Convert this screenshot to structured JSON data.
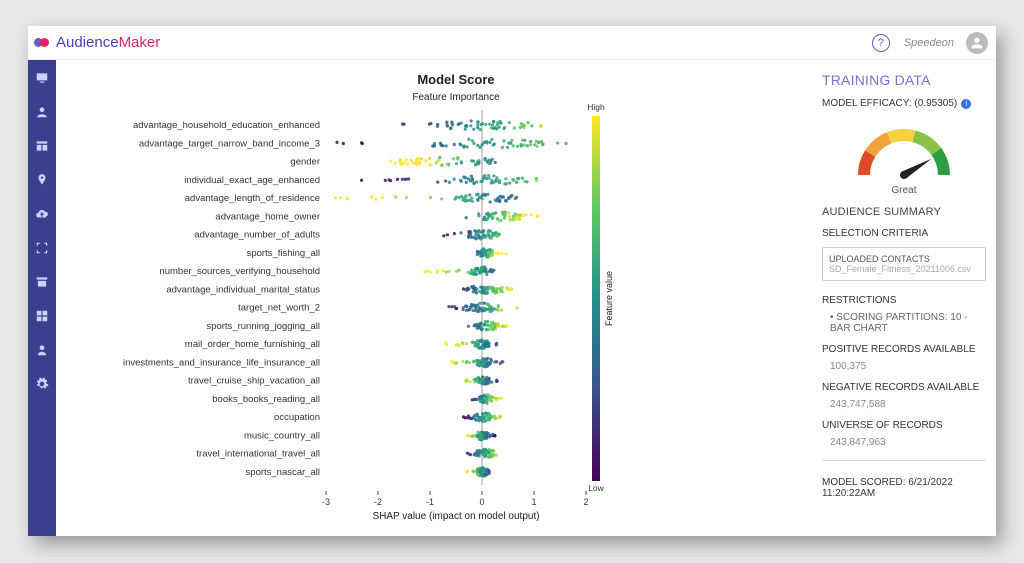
{
  "header": {
    "brand_a": "Audience",
    "brand_b": "Maker",
    "tenant": "Speedeon",
    "help_glyph": "?"
  },
  "nav_icons": [
    "monitor-icon",
    "users-icon",
    "table-icon",
    "pin-icon",
    "cloud-upload-icon",
    "scan-icon",
    "archive-icon",
    "app-grid-icon",
    "user-icon",
    "gear-icon"
  ],
  "panel": {
    "title": "TRAINING DATA",
    "efficacy_label": "MODEL EFFICACY: (0.95305)",
    "gauge_value": 0.83,
    "gauge_label": "Great",
    "summary_title": "AUDIENCE SUMMARY",
    "criteria_title": "SELECTION CRITERIA",
    "criteria_box_title": "UPLOADED CONTACTS",
    "criteria_box_value": "SD_Female_Fitness_20211006.csv",
    "restrictions_title": "RESTRICTIONS",
    "restrictions_item": "SCORING PARTITIONS: 10 - BAR CHART",
    "positive_label": "POSITIVE RECORDS AVAILABLE",
    "positive_value": "100,375",
    "negative_label": "NEGATIVE RECORDS AVAILABLE",
    "negative_value": "243,747,588",
    "universe_label": "UNIVERSE OF RECORDS",
    "universe_value": "243,847,963",
    "scored_label": "MODEL SCORED: 6/21/2022 11:20:22AM"
  },
  "chart_data": {
    "type": "beeswarm",
    "title": "Model Score",
    "subtitle": "Feature Importance",
    "xlabel": "SHAP value (impact on model output)",
    "colorbar_label": "Feature value",
    "colorbar_high": "High",
    "colorbar_low": "Low",
    "xlim": [
      -3,
      2
    ],
    "xticks": [
      -3,
      -2,
      -1,
      0,
      1,
      2
    ],
    "features": [
      {
        "name": "advantage_household_education_enhanced",
        "spread": [
          -1.8,
          1.3
        ],
        "bulk": [
          -0.9,
          0.9
        ],
        "tilt": 0.5
      },
      {
        "name": "advantage_target_narrow_band_income_3",
        "spread": [
          -3.0,
          2.0
        ],
        "bulk": [
          -1.0,
          1.2
        ],
        "tilt": 0.6
      },
      {
        "name": "gender",
        "spread": [
          -1.8,
          0.3
        ],
        "bulk": [
          -1.6,
          0.2
        ],
        "tilt": -0.7
      },
      {
        "name": "individual_exact_age_enhanced",
        "spread": [
          -2.6,
          1.2
        ],
        "bulk": [
          -0.7,
          0.9
        ],
        "tilt": 0.3
      },
      {
        "name": "advantage_length_of_residence",
        "spread": [
          -2.9,
          0.8
        ],
        "bulk": [
          -0.5,
          0.6
        ],
        "tilt": -0.2
      },
      {
        "name": "advantage_home_owner",
        "spread": [
          -0.4,
          1.1
        ],
        "bulk": [
          -0.1,
          0.8
        ],
        "tilt": 0.4
      },
      {
        "name": "advantage_number_of_adults",
        "spread": [
          -0.8,
          0.5
        ],
        "bulk": [
          -0.3,
          0.3
        ],
        "tilt": 0.0
      },
      {
        "name": "sports_fishing_all",
        "spread": [
          -0.1,
          0.5
        ],
        "bulk": [
          -0.05,
          0.2
        ],
        "tilt": 0.1
      },
      {
        "name": "number_sources_verifying_household",
        "spread": [
          -1.1,
          0.3
        ],
        "bulk": [
          -0.2,
          0.2
        ],
        "tilt": -0.3
      },
      {
        "name": "advantage_individual_marital_status",
        "spread": [
          -0.4,
          0.6
        ],
        "bulk": [
          -0.2,
          0.4
        ],
        "tilt": 0.2
      },
      {
        "name": "target_net_worth_2",
        "spread": [
          -0.7,
          0.7
        ],
        "bulk": [
          -0.3,
          0.4
        ],
        "tilt": 0.1
      },
      {
        "name": "sports_running_jogging_all",
        "spread": [
          -0.3,
          0.5
        ],
        "bulk": [
          -0.1,
          0.3
        ],
        "tilt": 0.2
      },
      {
        "name": "mail_order_home_furnishing_all",
        "spread": [
          -0.7,
          0.3
        ],
        "bulk": [
          -0.15,
          0.15
        ],
        "tilt": -0.2
      },
      {
        "name": "investments_and_insurance_life_insurance_all",
        "spread": [
          -0.6,
          0.4
        ],
        "bulk": [
          -0.1,
          0.2
        ],
        "tilt": -0.1
      },
      {
        "name": "travel_cruise_ship_vacation_all",
        "spread": [
          -0.4,
          0.3
        ],
        "bulk": [
          -0.1,
          0.15
        ],
        "tilt": -0.1
      },
      {
        "name": "books_books_reading_all",
        "spread": [
          -0.2,
          0.4
        ],
        "bulk": [
          -0.05,
          0.2
        ],
        "tilt": 0.1
      },
      {
        "name": "occupation",
        "spread": [
          -0.4,
          0.4
        ],
        "bulk": [
          -0.15,
          0.2
        ],
        "tilt": 0.0
      },
      {
        "name": "music_country_all",
        "spread": [
          -0.3,
          0.25
        ],
        "bulk": [
          -0.1,
          0.1
        ],
        "tilt": -0.05
      },
      {
        "name": "travel_international_travel_all",
        "spread": [
          -0.3,
          0.4
        ],
        "bulk": [
          -0.1,
          0.25
        ],
        "tilt": 0.1
      },
      {
        "name": "sports_nascar_all",
        "spread": [
          -0.3,
          0.2
        ],
        "bulk": [
          -0.1,
          0.1
        ],
        "tilt": -0.05
      }
    ]
  }
}
